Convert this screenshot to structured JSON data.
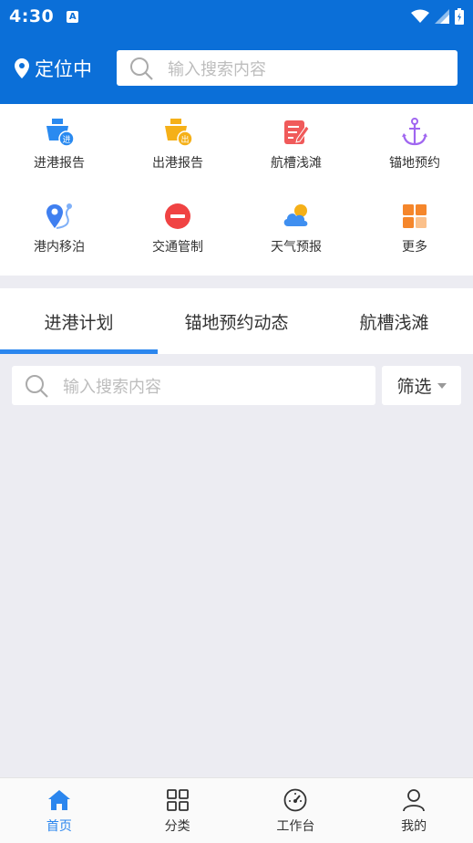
{
  "status_bar": {
    "time": "4:30",
    "notification_letter": "A"
  },
  "header": {
    "location_label": "定位中",
    "search_placeholder": "输入搜索内容"
  },
  "quick_actions": [
    {
      "label": "进港报告",
      "icon": "ship-in-icon",
      "color": "#2a8af0",
      "badge": "进"
    },
    {
      "label": "出港报告",
      "icon": "ship-out-icon",
      "color": "#f5b018",
      "badge": "出"
    },
    {
      "label": "航槽浅滩",
      "icon": "channel-edit-icon",
      "color": "#f05a5a"
    },
    {
      "label": "锚地预约",
      "icon": "anchor-icon",
      "color": "#a066f0"
    },
    {
      "label": "港内移泊",
      "icon": "route-pin-icon",
      "color": "#3f7ff0"
    },
    {
      "label": "交通管制",
      "icon": "no-entry-icon",
      "color": "#f04343"
    },
    {
      "label": "天气预报",
      "icon": "weather-icon",
      "color": "#3f8ff0"
    },
    {
      "label": "更多",
      "icon": "more-grid-icon",
      "color": "#f5862b"
    }
  ],
  "tabs": [
    {
      "label": "进港计划",
      "active": true
    },
    {
      "label": "锚地预约动态",
      "active": false
    },
    {
      "label": "航槽浅滩",
      "active": false
    }
  ],
  "list_search": {
    "placeholder": "输入搜索内容"
  },
  "filter": {
    "label": "筛选"
  },
  "bottom_nav": [
    {
      "label": "首页",
      "icon": "home-icon",
      "active": true
    },
    {
      "label": "分类",
      "icon": "category-icon",
      "active": false
    },
    {
      "label": "工作台",
      "icon": "dashboard-icon",
      "active": false
    },
    {
      "label": "我的",
      "icon": "profile-icon",
      "active": false
    }
  ],
  "colors": {
    "primary": "#0b6fd8",
    "accent": "#2b86ee"
  }
}
